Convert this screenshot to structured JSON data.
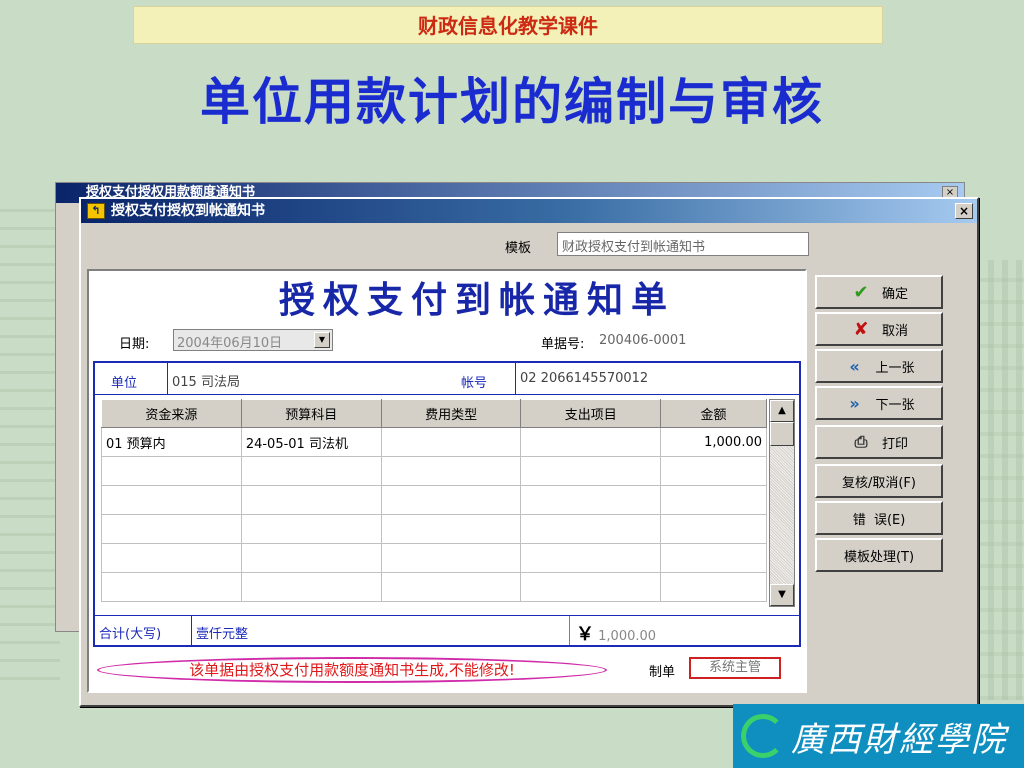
{
  "slide": {
    "course_banner": "财政信息化教学课件",
    "title": "单位用款计划的编制与审核"
  },
  "back_window": {
    "title": "授权支付授权用款额度通知书",
    "close": "×"
  },
  "window": {
    "title": "授权支付授权到帐通知书",
    "icon_char": "↰",
    "close": "×",
    "template_label": "模板",
    "template_value": "财政授权支付到帐通知书"
  },
  "form": {
    "title": "授权支付到帐通知单",
    "date_label": "日期:",
    "date_value": "2004年06月10日",
    "docno_label": "单据号:",
    "docno_value": "200406-0001",
    "unit_label": "单位",
    "unit_value": "015 司法局",
    "account_label": "帐号",
    "account_value": "02 2066145570012",
    "columns": [
      "资金来源",
      "预算科目",
      "费用类型",
      "支出项目",
      "金额"
    ],
    "rows": [
      [
        "01 预算内",
        "24-05-01 司法机",
        "",
        "",
        "1,000.00"
      ],
      [
        "",
        "",
        "",
        "",
        ""
      ],
      [
        "",
        "",
        "",
        "",
        ""
      ],
      [
        "",
        "",
        "",
        "",
        ""
      ],
      [
        "",
        "",
        "",
        "",
        ""
      ],
      [
        "",
        "",
        "",
        "",
        ""
      ]
    ],
    "total_label": "合计(大写)",
    "total_words": "壹仟元整",
    "total_symbol": "￥",
    "total_amount": "1,000.00",
    "notice": "该单据由授权支付用款额度通知书生成,不能修改!",
    "maker_label": "制单",
    "maker_value": "系统主管"
  },
  "buttons": {
    "confirm": "确定",
    "cancel": "取消",
    "prev": "上一张",
    "next": "下一张",
    "print": "打印",
    "review": "复核/取消(F)",
    "error": "错  误(E)",
    "template": "模板处理(T)"
  },
  "icons": {
    "confirm": "check-icon",
    "cancel": "x-icon",
    "prev": "double-left-arrow-icon",
    "next": "double-right-arrow-icon",
    "print": "printer-icon"
  },
  "logo": {
    "text": "廣西財經學院"
  }
}
